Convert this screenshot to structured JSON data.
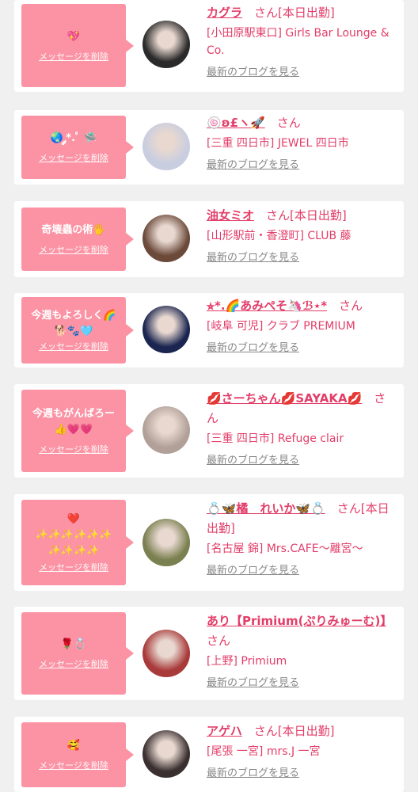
{
  "common": {
    "delete_label": "メッセージを削除",
    "blog_label": "最新のブログを見る",
    "san": "さん"
  },
  "cards": [
    {
      "message": "💖",
      "name": "カグラ",
      "tag": "[本日出勤]",
      "shop": "[小田原駅東口] Girls Bar Lounge & Co.",
      "avatar_color": "#2a2a2a"
    },
    {
      "message": "🌏 ༘*.ﾟ 🛸",
      "name": "🍥ʚ£ヽ🚀",
      "tag": "",
      "shop": "[三重 四日市] JEWEL 四日市",
      "avatar_color": "#c8cde0"
    },
    {
      "message": "奇壊蟲の術🖐",
      "name": "油女ミオ",
      "tag": "[本日出勤]",
      "shop": "[山形駅前・香澄町] CLUB 藤",
      "avatar_color": "#6b4a3a"
    },
    {
      "message": "今週もよろしく🌈\n🐕🐾🩵",
      "name": "⭐︎*.🌈あみぺそ🦄ℬ⋆*",
      "tag": "",
      "shop": "[岐阜 可児] クラブ PREMIUM",
      "avatar_color": "#1a2550"
    },
    {
      "message": "今週もがんばろー\n👍💗💗",
      "name": "💋さーちゃん💋SAYAKA💋",
      "tag": "",
      "shop": "[三重 四日市] Refuge clair",
      "avatar_color": "#b0a098"
    },
    {
      "message": "❤️\n✨✨✨✨✨✨\n✨✨✨✨",
      "name": "💍🦋橘　れいか🦋💍",
      "tag": "[本日出勤]",
      "shop": "[名古屋 錦] Mrs.CAFE〜離宮〜",
      "avatar_color": "#7a8050"
    },
    {
      "message": "🌹💍",
      "name": "あり【Primium(ぷりみゅーむ)】",
      "tag": "",
      "shop": "[上野] Primium",
      "avatar_color": "#a83a3a"
    },
    {
      "message": "🥰",
      "name": "アゲハ",
      "tag": "[本日出勤]",
      "shop": "[尾張 一宮] mrs.J 一宮",
      "avatar_color": "#3a3030"
    }
  ]
}
